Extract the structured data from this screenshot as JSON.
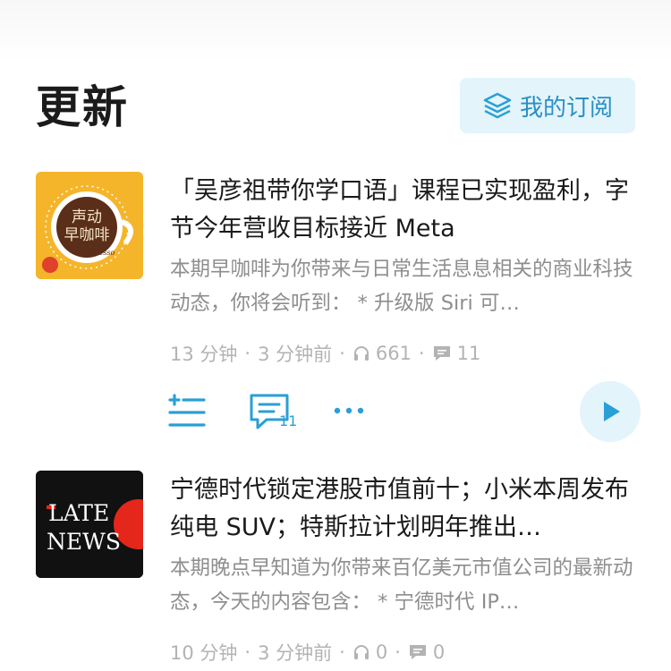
{
  "header": {
    "title": "更新",
    "subscriptions_label": "我的订阅"
  },
  "episodes": [
    {
      "cover": {
        "line1": "声动",
        "line2": "早咖啡",
        "sub": "Espresso"
      },
      "title": "「吴彦祖带你学口语」课程已实现盈利，字节今年营收目标接近 Meta",
      "description": "本期早咖啡为你带来与日常生活息息相关的商业科技动态，你将会听到： * 升级版 Siri 可…",
      "duration": "13 分钟",
      "published": "3 分钟前",
      "plays": "661",
      "comments": "11",
      "comment_badge": "11"
    },
    {
      "cover": {
        "line1": "LATE",
        "line2": "NEWS"
      },
      "title": "宁德时代锁定港股市值前十；小米本周发布纯电 SUV；特斯拉计划明年推出…",
      "description": "本期晚点早知道为你带来百亿美元市值公司的最新动态，今天的内容包含： * 宁德时代 IP…",
      "duration": "10 分钟",
      "published": "3 分钟前",
      "plays": "0",
      "comments": "0"
    }
  ],
  "colors": {
    "accent": "#2a9fd6",
    "subscribe_bg": "#e3f4fb",
    "meta_gray": "#b3b3b3"
  }
}
